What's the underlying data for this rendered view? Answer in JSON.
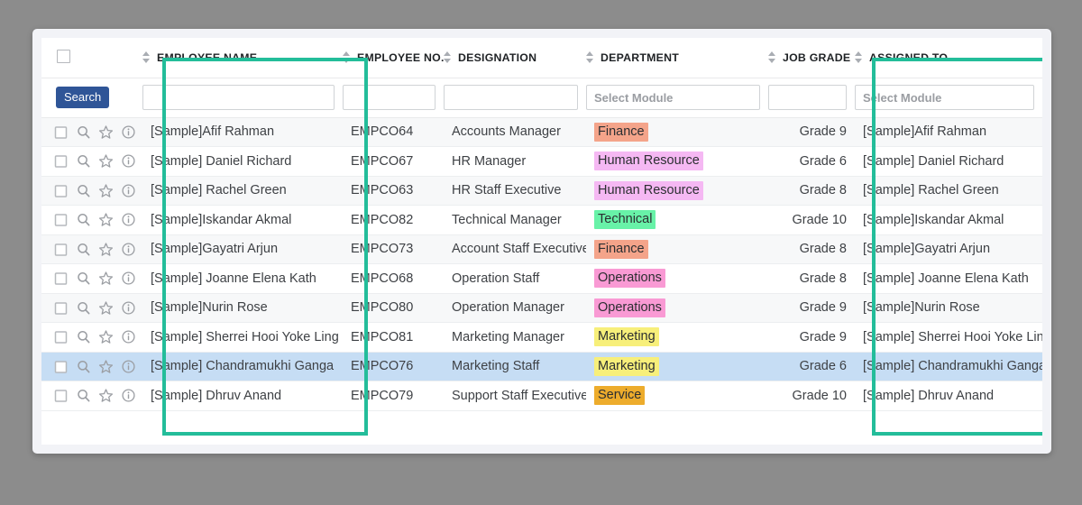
{
  "theme": {
    "highlight_border": "#23bd9a",
    "selected_row": "#c6ddf4",
    "search_button": "#2f5597",
    "page_background": "#8c8c8c",
    "card_background": "#f2f3f7"
  },
  "table": {
    "select_all_checkbox": "unchecked",
    "columns": [
      {
        "key": "actions",
        "label": "",
        "sortable": false
      },
      {
        "key": "name",
        "label": "EMPLOYEE NAME",
        "sortable": true
      },
      {
        "key": "no",
        "label": "EMPLOYEE NO.",
        "sortable": true
      },
      {
        "key": "desig",
        "label": "DESIGNATION",
        "sortable": true
      },
      {
        "key": "dept",
        "label": "DEPARTMENT",
        "sortable": true
      },
      {
        "key": "grade",
        "label": "JOB GRADE",
        "sortable": true
      },
      {
        "key": "assign",
        "label": "ASSIGNED TO",
        "sortable": true
      }
    ],
    "filters": {
      "search_button_label": "Search",
      "name": {
        "value": "",
        "placeholder": ""
      },
      "no": {
        "value": "",
        "placeholder": ""
      },
      "desig": {
        "value": "",
        "placeholder": ""
      },
      "dept": {
        "value": "",
        "placeholder": "Select Module"
      },
      "grade": {
        "value": "",
        "placeholder": ""
      },
      "assign": {
        "value": "",
        "placeholder": "Select Module"
      }
    },
    "row_icons": [
      "row-checkbox",
      "magnifier-icon",
      "star-icon",
      "info-icon"
    ],
    "rows": [
      {
        "name": "[Sample]Afif Rahman",
        "no": "EMPCO64",
        "desig": "Accounts Manager",
        "dept": "Finance",
        "dept_color": "#f4a48a",
        "grade": "Grade 9",
        "assign": "[Sample]Afif Rahman",
        "selected": false
      },
      {
        "name": "[Sample] Daniel Richard",
        "no": "EMPCO67",
        "desig": "HR Manager",
        "dept": "Human Resource",
        "dept_color": "#f5b8f3",
        "grade": "Grade 6",
        "assign": "[Sample] Daniel Richard",
        "selected": false
      },
      {
        "name": "[Sample] Rachel Green",
        "no": "EMPCO63",
        "desig": "HR Staff Executive",
        "dept": "Human Resource",
        "dept_color": "#f5b8f3",
        "grade": "Grade 8",
        "assign": "[Sample] Rachel Green",
        "selected": false
      },
      {
        "name": "[Sample]Iskandar Akmal",
        "no": "EMPCO82",
        "desig": "Technical Manager",
        "dept": "Technical",
        "dept_color": "#68f2a8",
        "grade": "Grade 10",
        "assign": "[Sample]Iskandar Akmal",
        "selected": false
      },
      {
        "name": "[Sample]Gayatri Arjun",
        "no": "EMPCO73",
        "desig": "Account Staff Executive",
        "dept": "Finance",
        "dept_color": "#f4a48a",
        "grade": "Grade 8",
        "assign": "[Sample]Gayatri Arjun",
        "selected": false
      },
      {
        "name": "[Sample] Joanne Elena Kath",
        "no": "EMPCO68",
        "desig": "Operation Staff",
        "dept": "Operations",
        "dept_color": "#f99ad4",
        "grade": "Grade 8",
        "assign": "[Sample] Joanne Elena Kath",
        "selected": false
      },
      {
        "name": "[Sample]Nurin Rose",
        "no": "EMPCO80",
        "desig": "Operation Manager",
        "dept": "Operations",
        "dept_color": "#f99ad4",
        "grade": "Grade 9",
        "assign": "[Sample]Nurin Rose",
        "selected": false
      },
      {
        "name": "[Sample] Sherrei Hooi Yoke Ling",
        "no": "EMPCO81",
        "desig": "Marketing Manager",
        "dept": "Marketing",
        "dept_color": "#f7ef7a",
        "grade": "Grade 9",
        "assign": "[Sample] Sherrei Hooi Yoke Ling",
        "selected": false
      },
      {
        "name": "[Sample] Chandramukhi Ganga",
        "no": "EMPCO76",
        "desig": "Marketing Staff",
        "dept": "Marketing",
        "dept_color": "#f7ef7a",
        "grade": "Grade 6",
        "assign": "[Sample] Chandramukhi Ganga",
        "selected": true
      },
      {
        "name": "[Sample] Dhruv Anand",
        "no": "EMPCO79",
        "desig": "Support Staff Executive",
        "dept": "Service",
        "dept_color": "#edac2c",
        "grade": "Grade 10",
        "assign": "[Sample] Dhruv Anand",
        "selected": false
      }
    ]
  },
  "highlights": [
    {
      "name": "employee-name-column-highlight",
      "column": "EMPLOYEE NAME"
    },
    {
      "name": "assigned-to-column-highlight",
      "column": "ASSIGNED TO"
    }
  ]
}
